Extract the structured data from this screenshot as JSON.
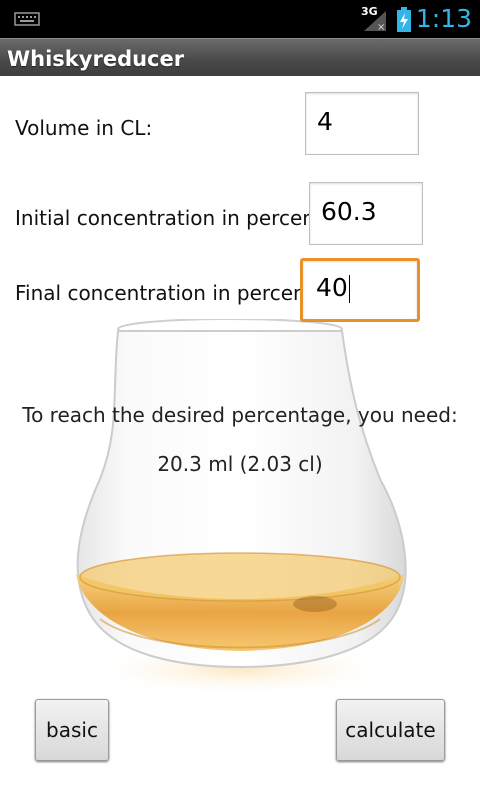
{
  "status_bar": {
    "network_label": "3G",
    "time": "1:13",
    "icons": [
      "keyboard-icon",
      "signal-icon",
      "battery-icon"
    ]
  },
  "app": {
    "title": "Whiskyreducer"
  },
  "form": {
    "volume": {
      "label": "Volume in CL:",
      "value": "4"
    },
    "initial": {
      "label": "Initial concentration in percent:",
      "value": "60.3"
    },
    "final": {
      "label": "Final concentration in percent:",
      "value": "40"
    }
  },
  "result": {
    "heading": "To reach the desired percentage, you need:",
    "value": "20.3 ml (2.03 cl)"
  },
  "buttons": {
    "basic": "basic",
    "calculate": "calculate"
  },
  "colors": {
    "accent": "#33b5e5",
    "focus_border": "#e8902a"
  }
}
